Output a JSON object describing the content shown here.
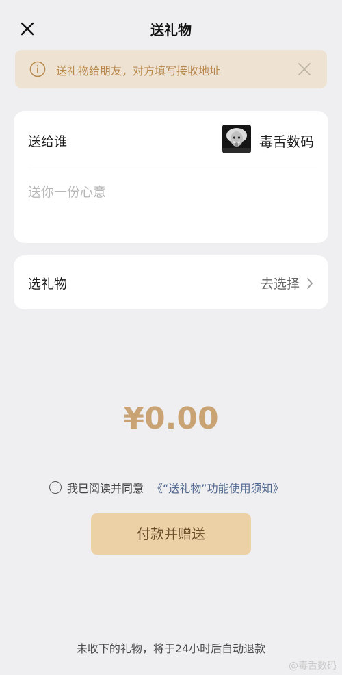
{
  "header": {
    "title": "送礼物",
    "close_icon": "close-icon"
  },
  "notice": {
    "text": "送礼物给朋友，对方填写接收地址",
    "icon": "info-icon",
    "close_icon": "close-icon"
  },
  "recipient": {
    "label": "送给谁",
    "name": "毒舌数码",
    "message_placeholder": "送你一份心意"
  },
  "gift": {
    "label": "选礼物",
    "choose_label": "去选择"
  },
  "amount": "¥0.00",
  "agreement": {
    "text": "我已阅读并同意",
    "link": "《“送礼物”功能使用须知》",
    "checked": false
  },
  "pay_button": "付款并赠送",
  "footer_note": "未收下的礼物，将于24小时后自动退款",
  "watermark": "@毒舌数码",
  "colors": {
    "accent": "#c9a373",
    "button_bg": "#ecd1a6",
    "notice_bg": "#eee3d2",
    "link": "#536a90"
  }
}
